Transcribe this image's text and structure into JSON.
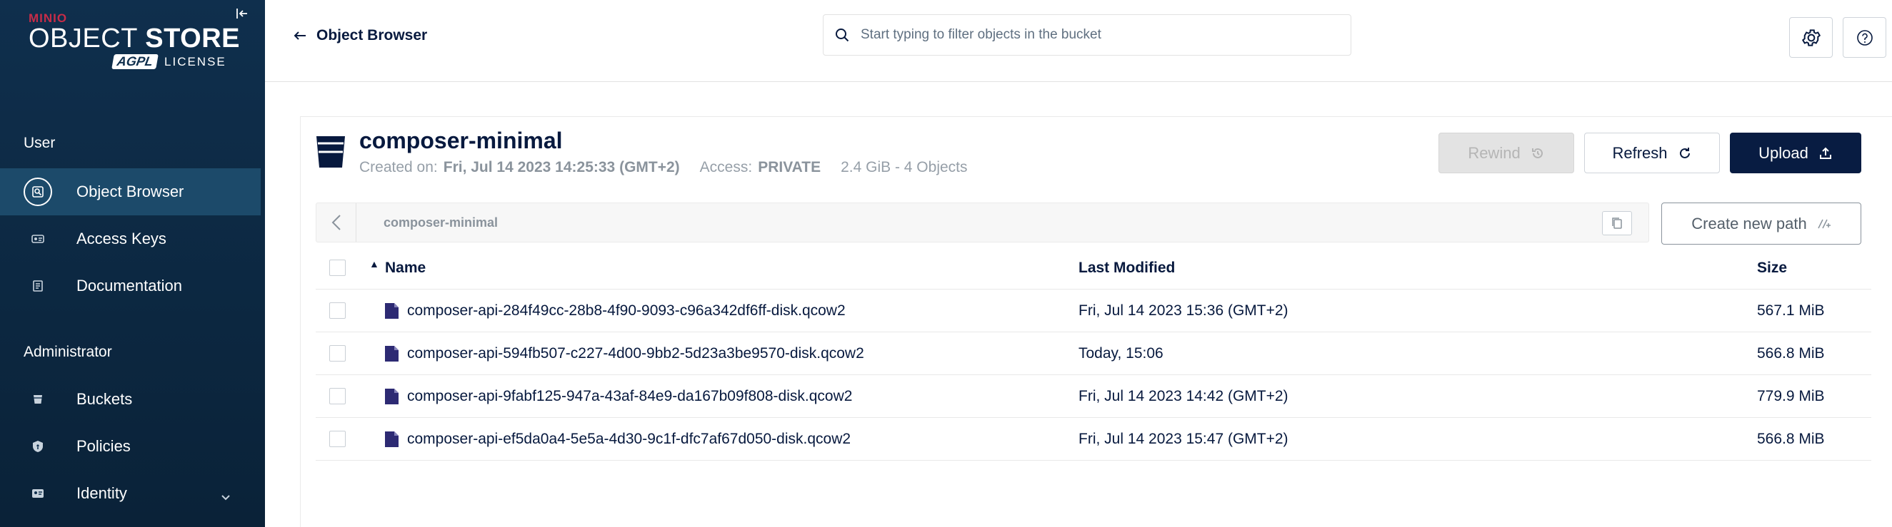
{
  "sidebar": {
    "logo": {
      "brand": "MINIO",
      "product_light": "OBJECT",
      "product_bold": "STORE",
      "badge": "AGPL",
      "license": "LICENSE"
    },
    "sections": [
      {
        "label": "User"
      },
      {
        "label": "Administrator"
      }
    ],
    "items": [
      {
        "label": "Object Browser",
        "icon": "object-browser-icon",
        "active": true
      },
      {
        "label": "Access Keys",
        "icon": "access-keys-icon"
      },
      {
        "label": "Documentation",
        "icon": "documentation-icon"
      },
      {
        "label": "Buckets",
        "icon": "buckets-icon"
      },
      {
        "label": "Policies",
        "icon": "policies-icon"
      },
      {
        "label": "Identity",
        "icon": "identity-icon"
      }
    ]
  },
  "header": {
    "back_label": "Object Browser",
    "search_placeholder": "Start typing to filter objects in the bucket"
  },
  "bucket": {
    "name": "composer-minimal",
    "created_label": "Created on:",
    "created_value": "Fri, Jul 14 2023 14:25:33 (GMT+2)",
    "access_label": "Access:",
    "access_value": "PRIVATE",
    "usage": "2.4 GiB - 4 Objects"
  },
  "actions": {
    "rewind": "Rewind",
    "refresh": "Refresh",
    "upload": "Upload",
    "create_path": "Create new path"
  },
  "path": "composer-minimal",
  "table": {
    "columns": [
      "Name",
      "Last Modified",
      "Size"
    ],
    "rows": [
      {
        "name": "composer-api-284f49cc-28b8-4f90-9093-c96a342df6ff-disk.qcow2",
        "modified": "Fri, Jul 14 2023 15:36 (GMT+2)",
        "size": "567.1 MiB"
      },
      {
        "name": "composer-api-594fb507-c227-4d00-9bb2-5d23a3be9570-disk.qcow2",
        "modified": "Today, 15:06",
        "size": "566.8 MiB"
      },
      {
        "name": "composer-api-9fabf125-947a-43af-84e9-da167b09f808-disk.qcow2",
        "modified": "Fri, Jul 14 2023 14:42 (GMT+2)",
        "size": "779.9 MiB"
      },
      {
        "name": "composer-api-ef5da0a4-5e5a-4d30-9c1f-dfc7af67d050-disk.qcow2",
        "modified": "Fri, Jul 14 2023 15:47 (GMT+2)",
        "size": "566.8 MiB"
      }
    ]
  }
}
